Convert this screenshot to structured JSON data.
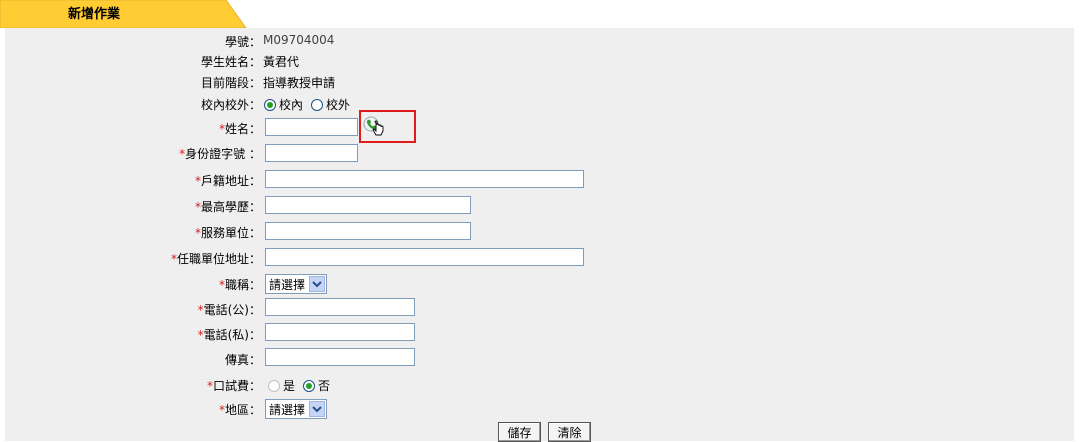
{
  "header": {
    "title": "新增作業"
  },
  "form": {
    "student_id": {
      "label": "學號：",
      "value": "M09704004"
    },
    "student_name": {
      "label": "學生姓名：",
      "value": "黃君代"
    },
    "stage": {
      "label": "目前階段：",
      "value": "指導教授申請"
    },
    "campus": {
      "label": "校內校外：",
      "options": [
        "校內",
        "校外"
      ],
      "selected": "校內"
    },
    "name": {
      "label": "姓名：",
      "required_mark": "*",
      "value": ""
    },
    "id_number": {
      "label": "身份證字號 ：",
      "required_mark": "*",
      "value": ""
    },
    "household_address": {
      "label": "戶籍地址：",
      "required_mark": "*",
      "value": ""
    },
    "education": {
      "label": "最高學歷：",
      "required_mark": "*",
      "value": ""
    },
    "employer": {
      "label": "服務單位：",
      "required_mark": "*",
      "value": ""
    },
    "employer_address": {
      "label": "任職單位地址：",
      "required_mark": "*",
      "value": ""
    },
    "job_title": {
      "label": "職稱：",
      "required_mark": "*",
      "selected": "請選擇"
    },
    "phone_office": {
      "label": "電話(公)：",
      "required_mark": "*",
      "value": ""
    },
    "phone_home": {
      "label": "電話(私)：",
      "required_mark": "*",
      "value": ""
    },
    "fax": {
      "label": "傳真：",
      "value": ""
    },
    "oral_fee": {
      "label": "口試費：",
      "required_mark": "*",
      "options": [
        "是",
        "否"
      ],
      "selected": "否"
    },
    "region": {
      "label": "地區：",
      "required_mark": "*",
      "selected": "請選擇"
    }
  },
  "actions": {
    "save_label": "儲存",
    "clear_label": "清除"
  },
  "icons": {
    "lookup": "phone-lookup-icon",
    "cursor": "hand-pointer-icon"
  },
  "colors": {
    "tab": "#ffcc33",
    "required": "#d42020",
    "panel": "#efefef",
    "highlight": "#e11b1b"
  }
}
